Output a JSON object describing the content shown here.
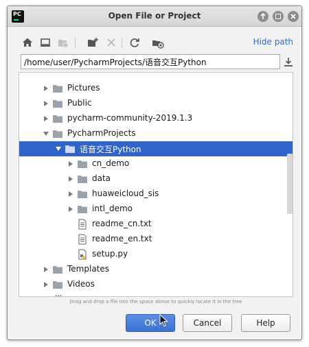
{
  "window": {
    "title": "Open File or Project",
    "app_icon_text": "PC"
  },
  "toolbar": {
    "icons": [
      "home-icon",
      "desktop-icon",
      "project-icon",
      "new-folder-icon",
      "delete-icon",
      "refresh-icon",
      "show-hidden-icon"
    ],
    "hide_path_label": "Hide path"
  },
  "path": {
    "value": "/home/user/PycharmProjects/语音交互Python"
  },
  "tree": {
    "items": [
      {
        "label": "Pictures",
        "type": "folder",
        "expanded": false
      },
      {
        "label": "Public",
        "type": "folder",
        "expanded": false
      },
      {
        "label": "pycharm-community-2019.1.3",
        "type": "folder",
        "expanded": false
      },
      {
        "label": "PycharmProjects",
        "type": "folder",
        "expanded": true
      },
      {
        "label": "语音交互Python",
        "type": "folder",
        "expanded": true,
        "selected": true
      },
      {
        "label": "cn_demo",
        "type": "folder",
        "expanded": false
      },
      {
        "label": "data",
        "type": "folder",
        "expanded": false
      },
      {
        "label": "huaweicloud_sis",
        "type": "folder",
        "expanded": false
      },
      {
        "label": "intl_demo",
        "type": "folder",
        "expanded": false
      },
      {
        "label": "readme_cn.txt",
        "type": "text-file"
      },
      {
        "label": "readme_en.txt",
        "type": "text-file"
      },
      {
        "label": "setup.py",
        "type": "python-file"
      },
      {
        "label": "Templates",
        "type": "folder",
        "expanded": false
      },
      {
        "label": "Videos",
        "type": "folder",
        "expanded": false
      },
      {
        "label": "lib",
        "type": "folder",
        "expanded": false
      }
    ]
  },
  "hint": "Drag and drop a file into the space above to quickly locate it in the tree",
  "buttons": {
    "ok": "OK",
    "cancel": "Cancel",
    "help": "Help"
  },
  "colors": {
    "selection": "#2f65ca",
    "link": "#2a6ed0",
    "folder": "#9aa3ad",
    "ok_button": "#4a7fdb"
  }
}
